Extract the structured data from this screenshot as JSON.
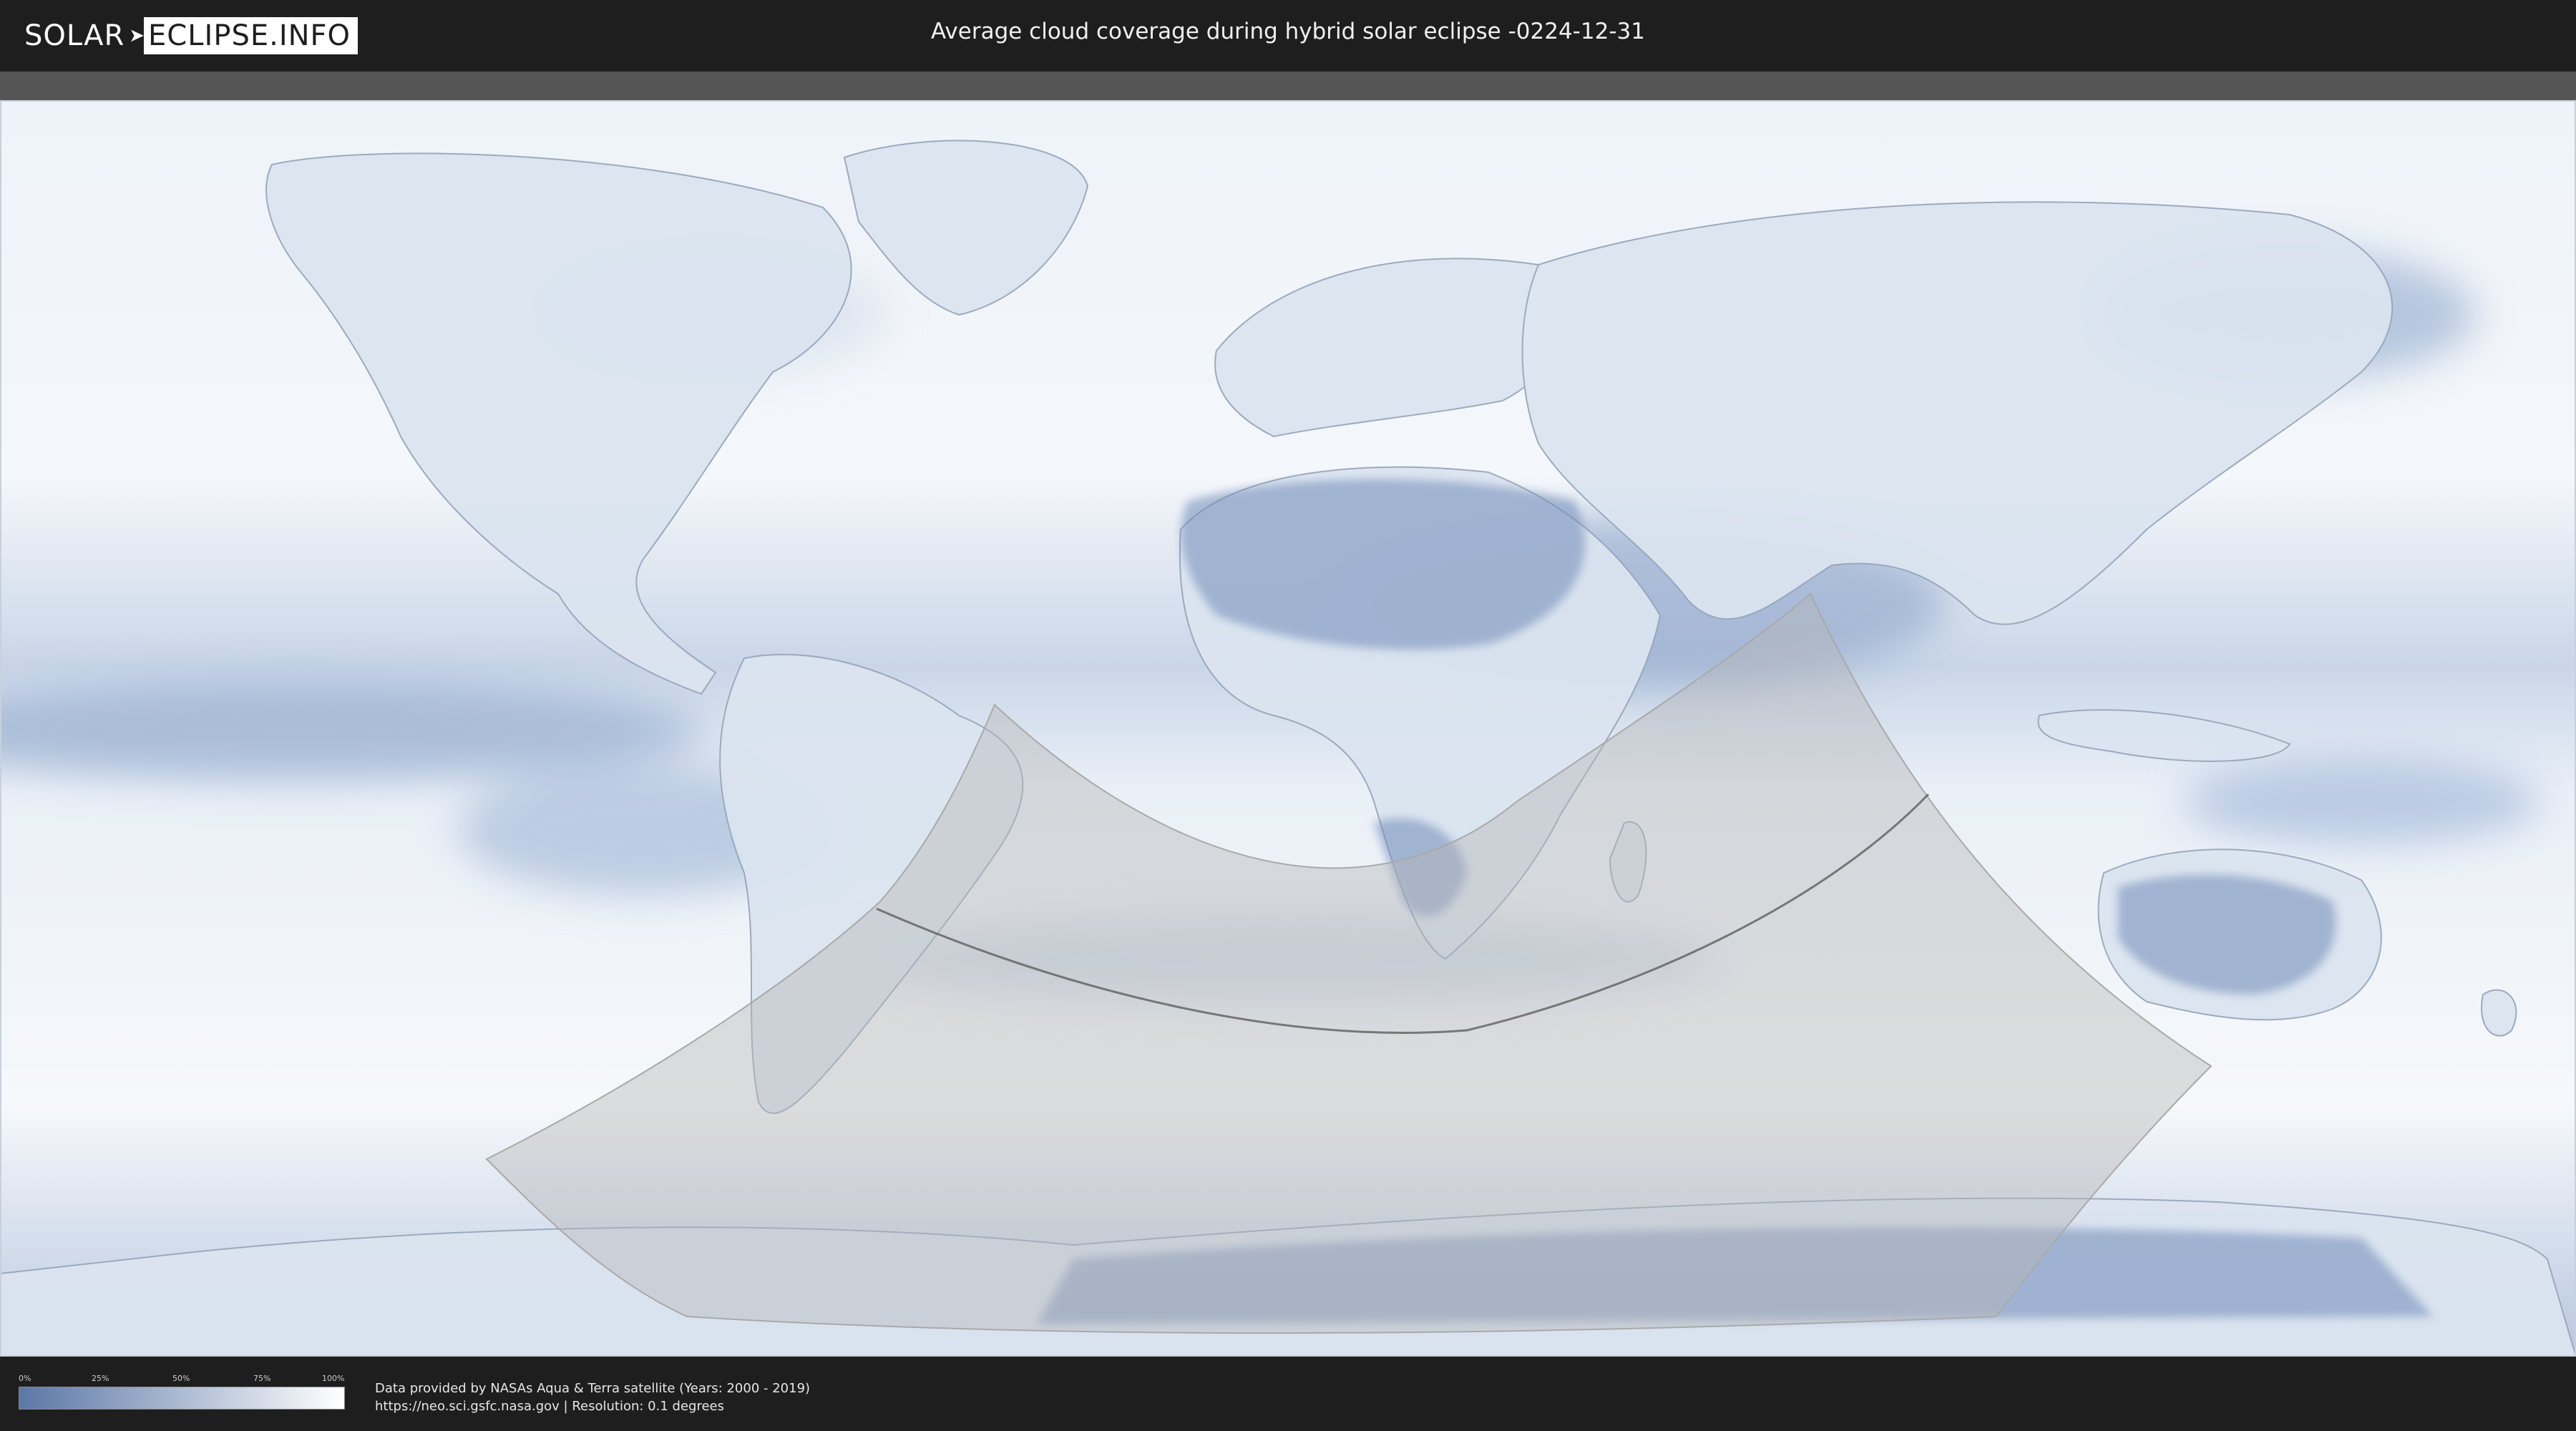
{
  "header": {
    "logo_solar": "SOLAR",
    "logo_eclipse": "ECLIPSE.INFO",
    "title": "Average cloud coverage during hybrid solar eclipse -0224-12-31"
  },
  "legend": {
    "ticks": [
      "0%",
      "25%",
      "50%",
      "75%",
      "100%"
    ],
    "color_low": "#5b77a6",
    "color_high": "#ffffff"
  },
  "credits": {
    "line1": "Data provided by NASAs Aqua & Terra satellite (Years: 2000 - 2019)",
    "line2": "https://neo.sci.gsfc.nasa.gov | Resolution: 0.1 degrees"
  },
  "colors": {
    "cloud_clear": "#6f8ab8",
    "cloud_full": "#ffffff",
    "shadow": "#b4b4b4",
    "central_line": "#555555"
  }
}
